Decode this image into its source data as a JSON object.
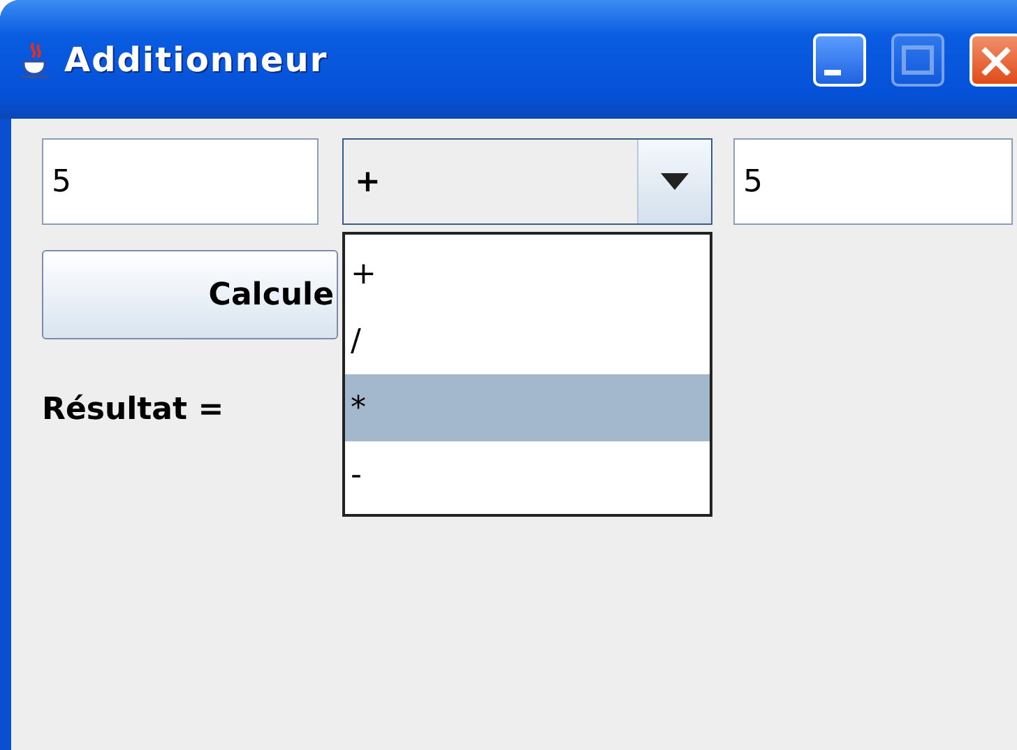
{
  "window": {
    "title": "Additionneur"
  },
  "title_buttons": [
    {
      "kind": "minimize",
      "disabled": false
    },
    {
      "kind": "maximize",
      "disabled": true
    },
    {
      "kind": "close",
      "disabled": false
    }
  ],
  "operand_1": {
    "value": "5"
  },
  "operator": {
    "value": "+",
    "expanded": true,
    "options": [
      {
        "label": "+",
        "highlighted": false
      },
      {
        "label": "/",
        "highlighted": false
      },
      {
        "label": "*",
        "highlighted": true
      },
      {
        "label": "-",
        "highlighted": false
      }
    ]
  },
  "operand_2": {
    "value": "5"
  },
  "calculate_button": {
    "label": "Calcule"
  },
  "result_label": "Résultat ="
}
